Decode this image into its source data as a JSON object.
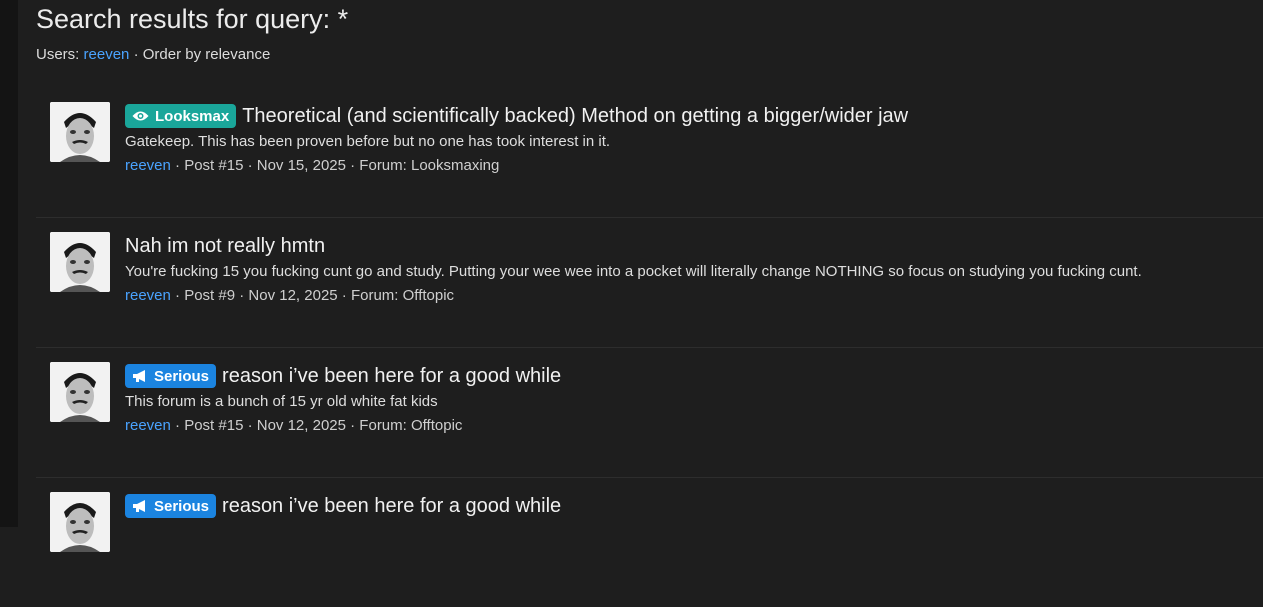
{
  "page": {
    "title": "Search results for query: *",
    "users_label": "Users:",
    "user_link": "reeven",
    "order_text": "· Order by relevance"
  },
  "colors": {
    "looksmax": "#1aa69a",
    "serious": "#1b84e0",
    "link": "#4aa3ff"
  },
  "results": [
    {
      "badge": "Looksmax",
      "badge_icon": "eye-icon",
      "title": "Theoretical (and scientifically backed) Method on getting a bigger/wider jaw",
      "snippet": "Gatekeep. This has been proven before but no one has took interest in it.",
      "author": "reeven",
      "meta": "· Post #15 · Nov 15, 2025 · Forum: Looksmaxing"
    },
    {
      "badge": "",
      "title": "Nah im not really hmtn",
      "snippet": "You're fucking 15 you fucking cunt go and study. Putting your wee wee into a pocket will literally change NOTHING so focus on studying you fucking cunt.",
      "author": "reeven",
      "meta": "· Post #9 · Nov 12, 2025 · Forum: Offtopic"
    },
    {
      "badge": "Serious",
      "badge_icon": "megaphone-icon",
      "title": "reason i’ve been here for a good while",
      "snippet": "This forum is a bunch of 15 yr old white fat kids",
      "author": "reeven",
      "meta": "· Post #15 · Nov 12, 2025 · Forum: Offtopic"
    },
    {
      "badge": "Serious",
      "badge_icon": "megaphone-icon",
      "title": "reason i’ve been here for a good while",
      "snippet": "",
      "author": "",
      "meta": ""
    }
  ]
}
